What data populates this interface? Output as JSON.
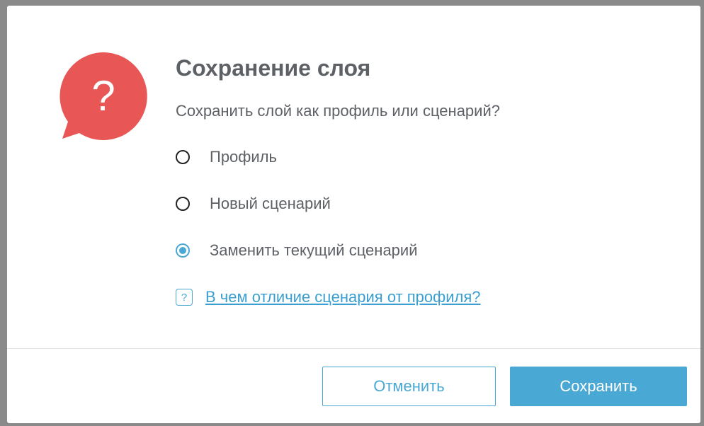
{
  "dialog": {
    "title": "Сохранение слоя",
    "question": "Сохранить слой как профиль или сценарий?",
    "icon": "question-bubble-icon",
    "icon_symbol": "?",
    "options": [
      {
        "label": "Профиль",
        "checked": false
      },
      {
        "label": "Новый сценарий",
        "checked": false
      },
      {
        "label": "Заменить текущий сценарий",
        "checked": true
      }
    ],
    "help": {
      "icon_symbol": "?",
      "link_text": "В чем отличие сценария от профиля?"
    },
    "buttons": {
      "cancel_label": "Отменить",
      "save_label": "Сохранить"
    }
  },
  "colors": {
    "accent": "#4aa8d4",
    "icon_red": "#e85656",
    "text": "#5d6166"
  }
}
